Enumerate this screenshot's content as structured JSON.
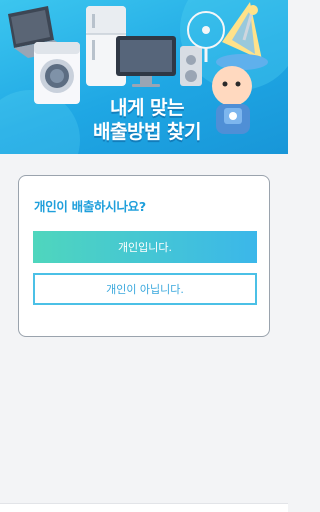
{
  "banner": {
    "title_line1": "내게 맞는",
    "title_line2": "배출방법 찾기",
    "background_color": "#22aee8",
    "illustrations": [
      "laptop-icon",
      "refrigerator-icon",
      "washing-machine-icon",
      "monitor-icon",
      "speaker-icon",
      "fan-icon",
      "mascot-wizard-icon"
    ]
  },
  "card": {
    "question": "개인이 배출하시나요?",
    "yes_label": "개인입니다.",
    "no_label": "개인이 아닙니다."
  },
  "colors": {
    "accent": "#1f9fdb",
    "button_gradient_start": "#4fd6bd",
    "button_gradient_end": "#3bb7ea"
  }
}
